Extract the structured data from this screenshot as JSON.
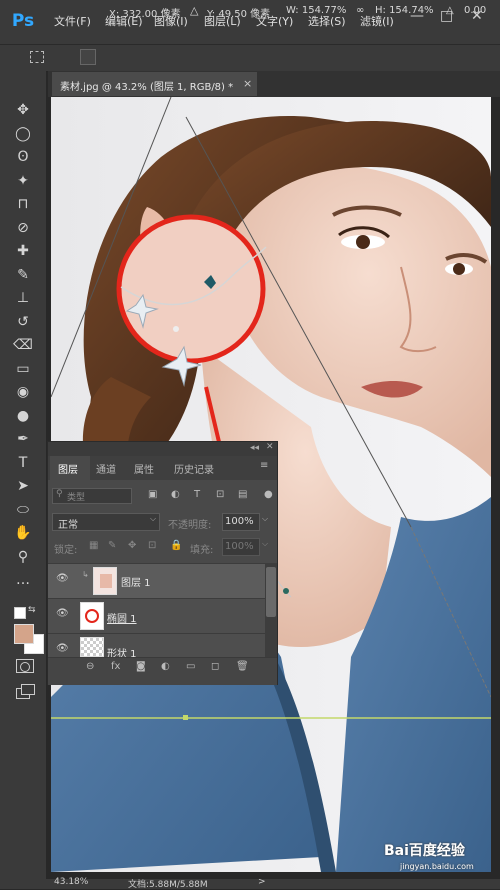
{
  "app": {
    "logo": "Ps"
  },
  "menu": [
    "文件(F)",
    "编辑(E)",
    "图像(I)",
    "图层(L)",
    "文字(Y)",
    "选择(S)",
    "滤镜(I)"
  ],
  "window_controls": {
    "minimize": "—",
    "maximize": "□",
    "close": "✕"
  },
  "options": {
    "x": "X: 332.00 像素",
    "y": "Y: 49.50 像素",
    "w": "W: 154.77%",
    "link": "∞",
    "h": "H: 154.74%",
    "h_degree": "0.00"
  },
  "doc_tab": {
    "label": "素材.jpg @ 43.2% (图层 1, RGB/8) *",
    "close": "×"
  },
  "tools": [
    "move-icon",
    "marquee-icon",
    "lasso-icon",
    "magic-wand-icon",
    "crop-icon",
    "eyedropper-icon",
    "healing-icon",
    "brush-icon",
    "stamp-icon",
    "history-brush-icon",
    "eraser-icon",
    "gradient-icon",
    "blur-icon",
    "dodge-icon",
    "pen-icon",
    "type-icon",
    "path-select-icon",
    "shape-icon",
    "hand-icon",
    "zoom-icon",
    "more-icon"
  ],
  "tool_glyphs": [
    "✥",
    "◯",
    "ʘ",
    "✦",
    "⊓",
    "⊘",
    "✚",
    "✎",
    "⊥",
    "↺",
    "⌫",
    "▭",
    "◉",
    "●",
    "✒",
    "T",
    "➤",
    "⬭",
    "✋",
    "⚲",
    "…"
  ],
  "colors": {
    "foreground": "#d4a48a",
    "background": "#ffffff",
    "accent_ring": "#e3261b",
    "guide": "#c4d86a"
  },
  "layers_panel": {
    "tabs": [
      "图层",
      "通道",
      "属性",
      "历史记录"
    ],
    "filter_placeholder": "类型",
    "blend_mode": "正常",
    "opacity_label": "不透明度:",
    "opacity_value": "100%",
    "lock_label": "锁定:",
    "fill_label": "填充:",
    "fill_value": "100%",
    "layers": [
      {
        "name": "图层 1",
        "visible": true,
        "selected": true
      },
      {
        "name": "椭圆 1",
        "visible": true,
        "selected": false
      },
      {
        "name": "形状 1",
        "visible": true,
        "selected": false
      }
    ],
    "footer_icons": [
      "link-icon",
      "fx-icon",
      "mask-icon",
      "adjustment-icon",
      "folder-icon",
      "new-layer-icon",
      "trash-icon"
    ],
    "footer_glyphs": [
      "⊖",
      "fx",
      "◙",
      "◐",
      "▭",
      "◻",
      "🗑"
    ]
  },
  "status": {
    "zoom": "43.18%",
    "doc": "文档:5.88M/5.88M",
    "arrow": ">"
  },
  "watermark": {
    "brand": "Bai百度经验",
    "url": "jingyan.baidu.com"
  }
}
